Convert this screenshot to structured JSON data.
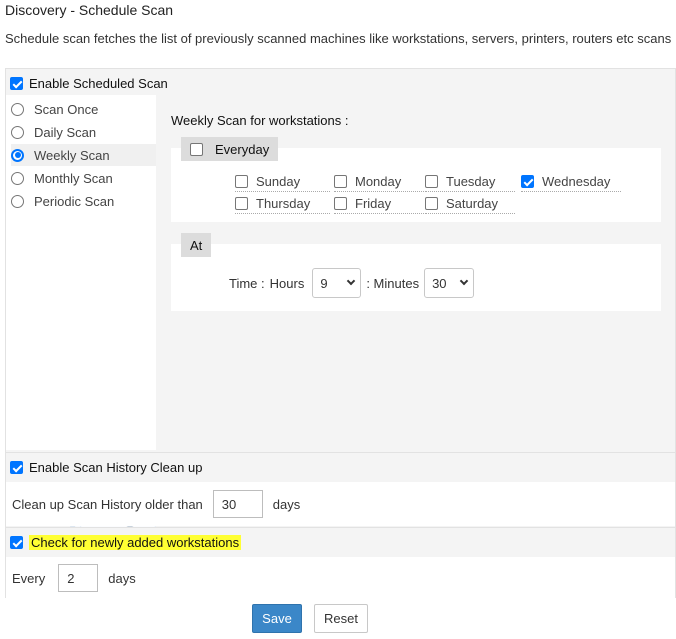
{
  "page": {
    "title": "Discovery - Schedule Scan",
    "description": "Schedule scan fetches the list of previously scanned machines like workstations, servers, printers, routers etc scans"
  },
  "scheduled": {
    "enable_label": "Enable Scheduled Scan",
    "enabled": true,
    "options": [
      "Scan Once",
      "Daily Scan",
      "Weekly Scan",
      "Monthly Scan",
      "Periodic Scan"
    ],
    "selected": "Weekly Scan"
  },
  "weekly": {
    "title": "Weekly Scan for workstations :",
    "everyday_label": "Everyday",
    "days": [
      {
        "label": "Sunday",
        "checked": false
      },
      {
        "label": "Monday",
        "checked": false
      },
      {
        "label": "Tuesday",
        "checked": false
      },
      {
        "label": "Wednesday",
        "checked": true
      },
      {
        "label": "Thursday",
        "checked": false
      },
      {
        "label": "Friday",
        "checked": false
      },
      {
        "label": "Saturday",
        "checked": false
      }
    ],
    "at_label": "At",
    "time_label": "Time :",
    "hours_label": "Hours",
    "hours_value": "9",
    "minutes_label": ": Minutes",
    "minutes_value": "30"
  },
  "history": {
    "enable_label": "Enable Scan History Clean up",
    "enabled": true,
    "text_before": "Clean up Scan History older than",
    "value": "30",
    "text_after": "days"
  },
  "newly": {
    "enable_label": "Check for newly added workstations",
    "enabled": true,
    "every_label": "Every",
    "value": "2",
    "days_label": "days"
  },
  "actions": {
    "save_label": "Save",
    "reset_label": "Reset"
  },
  "colors": {
    "accent": "#0075ff",
    "save_button": "#3b87c8",
    "highlight": "#ffff33"
  }
}
